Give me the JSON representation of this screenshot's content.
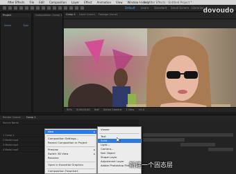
{
  "menubar": {
    "items": [
      "After Effects",
      "File",
      "Edit",
      "Composition",
      "Layer",
      "Effect",
      "Animation",
      "View",
      "Window",
      "Help"
    ],
    "window_title": "Adobe After Effects - Untitled Project *"
  },
  "toolbar": {
    "workspaces": [
      "Default",
      "Learn",
      "Standard",
      "Small Screen",
      "Libraries"
    ]
  },
  "watermark": "doyoudo",
  "project_panel": {
    "tab": "Project",
    "composition_tab": "Composition: Comp 1",
    "items": [
      "Name",
      "Type"
    ]
  },
  "viewer": {
    "tabs": [
      "Comp 1",
      "Layer (none)",
      "Footage (none)"
    ],
    "bottom_bar": [
      "50%",
      "0;00;00;00",
      "Half",
      "Active Camera",
      "1 View",
      "+0.0"
    ]
  },
  "timeline": {
    "tabs": [
      "Render Queue",
      "Comp 1"
    ],
    "layers": [
      "Source Name",
      "1  Comp 1",
      "2  Model.mp4",
      "3  Model.mp4",
      "4  Model.mp4"
    ]
  },
  "context_menu": {
    "items": [
      {
        "label": "New",
        "submenu": true,
        "highlight": true
      },
      {
        "label": "Composition Settings...",
        "submenu": false
      },
      {
        "label": "Reveal Composition in Project",
        "submenu": false
      },
      {
        "label": "Preview",
        "submenu": true
      },
      {
        "label": "Switch 3D View",
        "submenu": true
      },
      {
        "label": "Rename",
        "submenu": false
      },
      {
        "label": "Open in Essential Graphics",
        "submenu": false
      },
      {
        "label": "Composition Flowchart",
        "submenu": false
      }
    ]
  },
  "submenu": {
    "items": [
      {
        "label": "Viewer",
        "highlight": false
      },
      {
        "label": "Text",
        "highlight": false
      },
      {
        "label": "Solid...",
        "highlight": true
      },
      {
        "label": "Light...",
        "highlight": false
      },
      {
        "label": "Camera...",
        "highlight": false
      },
      {
        "label": "Null Object",
        "highlight": false
      },
      {
        "label": "Shape Layer",
        "highlight": false
      },
      {
        "label": "Adjustment Layer",
        "highlight": false
      },
      {
        "label": "Adobe Photoshop File...",
        "highlight": false
      }
    ]
  },
  "subtitle": "新建一个固态层",
  "colors": {
    "highlight": "#2f7ae0",
    "accent_blue": "#4aa3ff",
    "panel_bg": "#202020"
  }
}
